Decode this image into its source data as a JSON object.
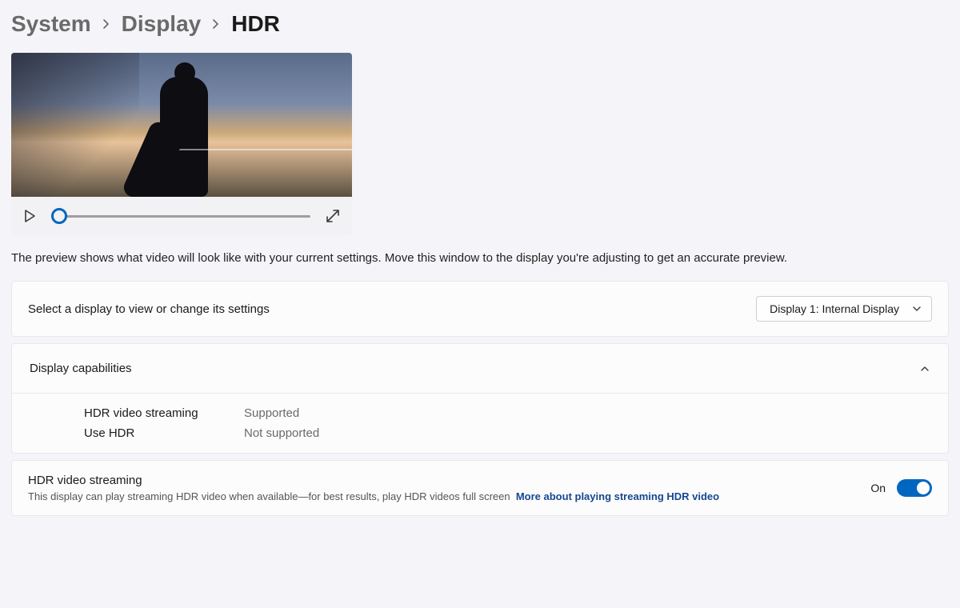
{
  "breadcrumb": {
    "items": [
      "System",
      "Display",
      "HDR"
    ]
  },
  "preview": {
    "hint": "The preview shows what video will look like with your current settings. Move this window to the display you're adjusting to get an accurate preview.",
    "play_icon": "play",
    "expand_icon": "expand"
  },
  "display_select": {
    "label": "Select a display to view or change its settings",
    "value": "Display 1: Internal Display"
  },
  "capabilities": {
    "header": "Display capabilities",
    "rows": [
      {
        "label": "HDR video streaming",
        "value": "Supported"
      },
      {
        "label": "Use HDR",
        "value": "Not supported"
      }
    ]
  },
  "streaming": {
    "title": "HDR video streaming",
    "desc": "This display can play streaming HDR video when available—for best results, play HDR videos full screen",
    "link": "More about playing streaming HDR video",
    "toggle_label": "On",
    "toggle_on": true
  }
}
